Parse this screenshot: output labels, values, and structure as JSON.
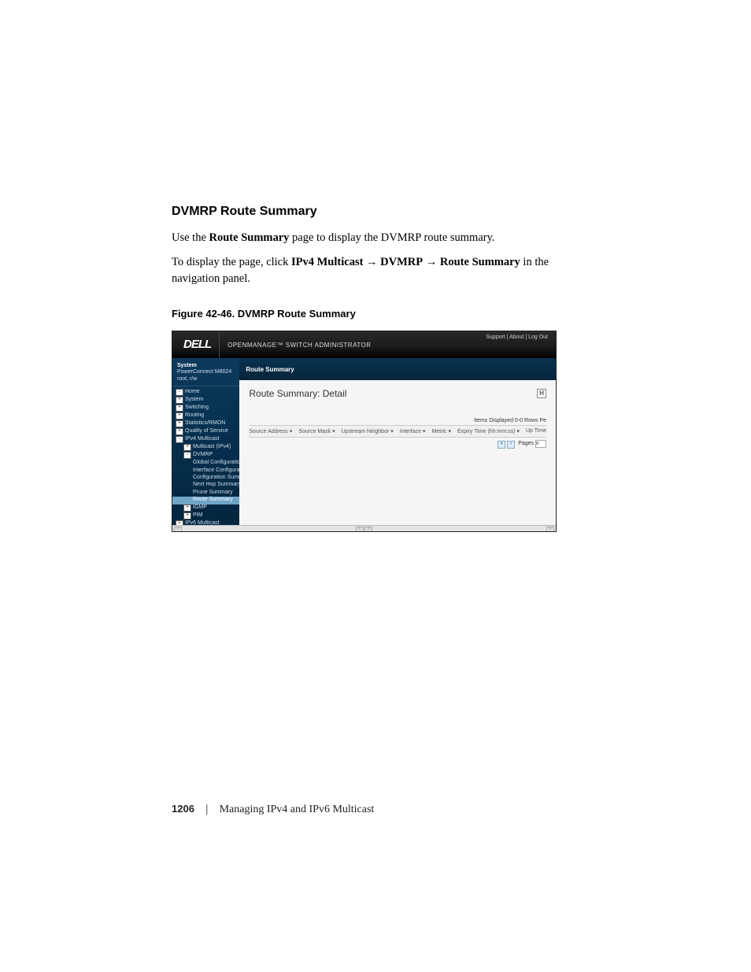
{
  "heading": "DVMRP Route Summary",
  "para1_prefix": "Use the ",
  "para1_bold": "Route Summary",
  "para1_suffix": " page to display the DVMRP route summary.",
  "para2_prefix": "To display the page, click ",
  "para2_b1": "IPv4 Multicast",
  "para2_arrow1": " → ",
  "para2_b2": "DVMRP",
  "para2_arrow2": " → ",
  "para2_b3": "Route Summary",
  "para2_suffix": " in the navigation panel.",
  "figure_caption": "Figure 42-46.    DVMRP Route Summary",
  "screenshot": {
    "logo": "DELL",
    "product": "OPENMANAGE™ SWITCH ADMINISTRATOR",
    "top_links": "Support  |  About  |  Log Out",
    "sidebar": {
      "head": "System",
      "sub1": "PowerConnect M8024",
      "sub2": "root, r/w",
      "items": [
        {
          "icon": "minus",
          "indent": 0,
          "label": "Home"
        },
        {
          "icon": "plus",
          "indent": 0,
          "label": "System"
        },
        {
          "icon": "plus",
          "indent": 0,
          "label": "Switching"
        },
        {
          "icon": "plus",
          "indent": 0,
          "label": "Routing"
        },
        {
          "icon": "plus",
          "indent": 0,
          "label": "Statistics/RMON"
        },
        {
          "icon": "plus",
          "indent": 0,
          "label": "Quality of Service"
        },
        {
          "icon": "minus",
          "indent": 0,
          "label": "IPv4 Multicast"
        },
        {
          "icon": "plus",
          "indent": 1,
          "label": "Multicast (IPv4)"
        },
        {
          "icon": "minus",
          "indent": 1,
          "label": "DVMRP"
        },
        {
          "icon": "",
          "indent": 2,
          "label": "Global Configuratio"
        },
        {
          "icon": "",
          "indent": 2,
          "label": "Interface Configurat"
        },
        {
          "icon": "",
          "indent": 2,
          "label": "Configuration Summ"
        },
        {
          "icon": "",
          "indent": 2,
          "label": "Next Hop Summary"
        },
        {
          "icon": "",
          "indent": 2,
          "label": "Prune Summary"
        },
        {
          "icon": "",
          "indent": 2,
          "label": "Route Summary",
          "sel": true
        },
        {
          "icon": "plus",
          "indent": 1,
          "label": "IGMP"
        },
        {
          "icon": "plus",
          "indent": 1,
          "label": "PIM"
        },
        {
          "icon": "plus",
          "indent": 0,
          "label": "IPv6 Multicast"
        }
      ]
    },
    "crumb": "Route Summary",
    "detail_title": "Route Summary: Detail",
    "items_displayed": "Items Displayed 0-0    Rows Pe",
    "columns": [
      "Source Address  ▾",
      "Source Mask  ▾",
      "Upstream Neighbor  ▾",
      "Interface  ▾",
      "Metric  ▾",
      "Expiry Time (hh:mm:ss)  ▾",
      "Up Time"
    ],
    "pager_label": "Pages",
    "pager_value": "0"
  },
  "footer": {
    "page_number": "1206",
    "chapter": "Managing IPv4 and IPv6 Multicast"
  }
}
